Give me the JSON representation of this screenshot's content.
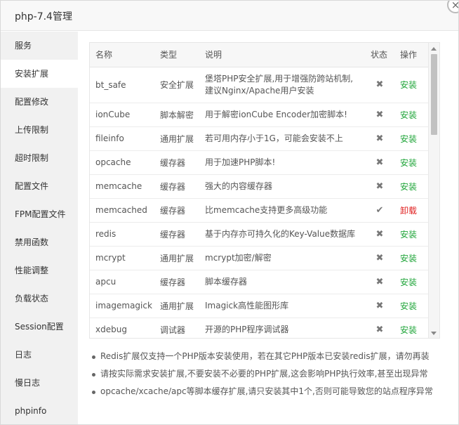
{
  "window": {
    "title": "php-7.4管理"
  },
  "sidebar": {
    "items": [
      {
        "label": "服务"
      },
      {
        "label": "安装扩展"
      },
      {
        "label": "配置修改"
      },
      {
        "label": "上传限制"
      },
      {
        "label": "超时限制"
      },
      {
        "label": "配置文件"
      },
      {
        "label": "FPM配置文件"
      },
      {
        "label": "禁用函数"
      },
      {
        "label": "性能调整"
      },
      {
        "label": "负载状态"
      },
      {
        "label": "Session配置"
      },
      {
        "label": "日志"
      },
      {
        "label": "慢日志"
      },
      {
        "label": "phpinfo"
      }
    ],
    "active_index": 1
  },
  "table": {
    "headers": {
      "name": "名称",
      "type": "类型",
      "desc": "说明",
      "status": "状态",
      "action": "操作"
    },
    "rows": [
      {
        "name": "bt_safe",
        "type": "安全扩展",
        "desc1": "堡塔PHP安全扩展,用于增强防跨站机制,",
        "desc2": "建议Nginx/Apache用户安装",
        "status": "✖",
        "action": "安装"
      },
      {
        "name": "ionCube",
        "type": "脚本解密",
        "desc1": "用于解密ionCube Encoder加密脚本!",
        "status": "✖",
        "action": "安装"
      },
      {
        "name": "fileinfo",
        "type": "通用扩展",
        "desc1": "若可用内存小于1G，可能会安装不上",
        "status": "✖",
        "action": "安装"
      },
      {
        "name": "opcache",
        "type": "缓存器",
        "desc1": "用于加速PHP脚本!",
        "status": "✖",
        "action": "安装"
      },
      {
        "name": "memcache",
        "type": "缓存器",
        "desc1": "强大的内容缓存器",
        "status": "✖",
        "action": "安装"
      },
      {
        "name": "memcached",
        "type": "缓存器",
        "desc1": "比memcache支持更多高级功能",
        "status": "✔",
        "action": "卸载"
      },
      {
        "name": "redis",
        "type": "缓存器",
        "desc1": "基于内存亦可持久化的Key-Value数据库",
        "status": "✖",
        "action": "安装"
      },
      {
        "name": "mcrypt",
        "type": "通用扩展",
        "desc1": "mcrypt加密/解密",
        "status": "✖",
        "action": "安装"
      },
      {
        "name": "apcu",
        "type": "缓存器",
        "desc1": "脚本缓存器",
        "status": "✖",
        "action": "安装"
      },
      {
        "name": "imagemagick",
        "type": "通用扩展",
        "desc1": "Imagick高性能图形库",
        "status": "✖",
        "action": "安装"
      },
      {
        "name": "xdebug",
        "type": "调试器",
        "desc1": "开源的PHP程序调试器",
        "status": "✖",
        "action": "安装"
      }
    ]
  },
  "notes": [
    "Redis扩展仅支持一个PHP版本安装使用，若在其它PHP版本已安装redis扩展，请勿再装",
    "请按实际需求安装扩展,不要安装不必要的PHP扩展,这会影响PHP执行效率,甚至出现异常",
    "opcache/xcache/apc等脚本缓存扩展,请只安装其中1个,否则可能导致您的站点程序异常"
  ],
  "colors": {
    "install": "#20a53a",
    "uninstall": "#e02020"
  }
}
